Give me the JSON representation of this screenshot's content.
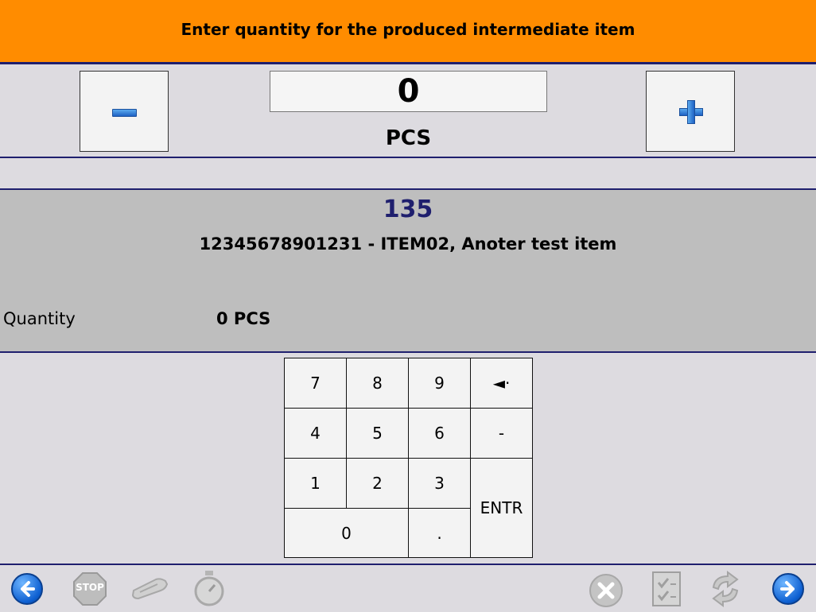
{
  "header": {
    "title": "Enter quantity for the produced intermediate item"
  },
  "quantity": {
    "value": "0",
    "unit": "PCS"
  },
  "info": {
    "id": "135",
    "item": "12345678901231 - ITEM02, Anoter test item",
    "qty_label": "Quantity",
    "qty_value": "0 PCS"
  },
  "keypad": {
    "k7": "7",
    "k8": "8",
    "k9": "9",
    "backspace": "◄·",
    "k4": "4",
    "k5": "5",
    "k6": "6",
    "minus": "-",
    "k1": "1",
    "k2": "2",
    "k3": "3",
    "enter": "ENTR",
    "k0": "0",
    "dot": "."
  },
  "footer": {
    "stop_label": "STOP"
  },
  "icons": {
    "back": "back-arrow-icon",
    "stop": "stop-sign-icon",
    "scanner": "scanner-icon",
    "stopwatch": "stopwatch-icon",
    "cancel": "cancel-x-icon",
    "checklist": "checklist-icon",
    "refresh": "refresh-icon",
    "forward": "forward-arrow-icon"
  },
  "colors": {
    "header_bg": "#ff8c00",
    "divider": "#1f1f6e",
    "info_bg": "#bebebe",
    "accent_blue": "#0d5fd1"
  }
}
